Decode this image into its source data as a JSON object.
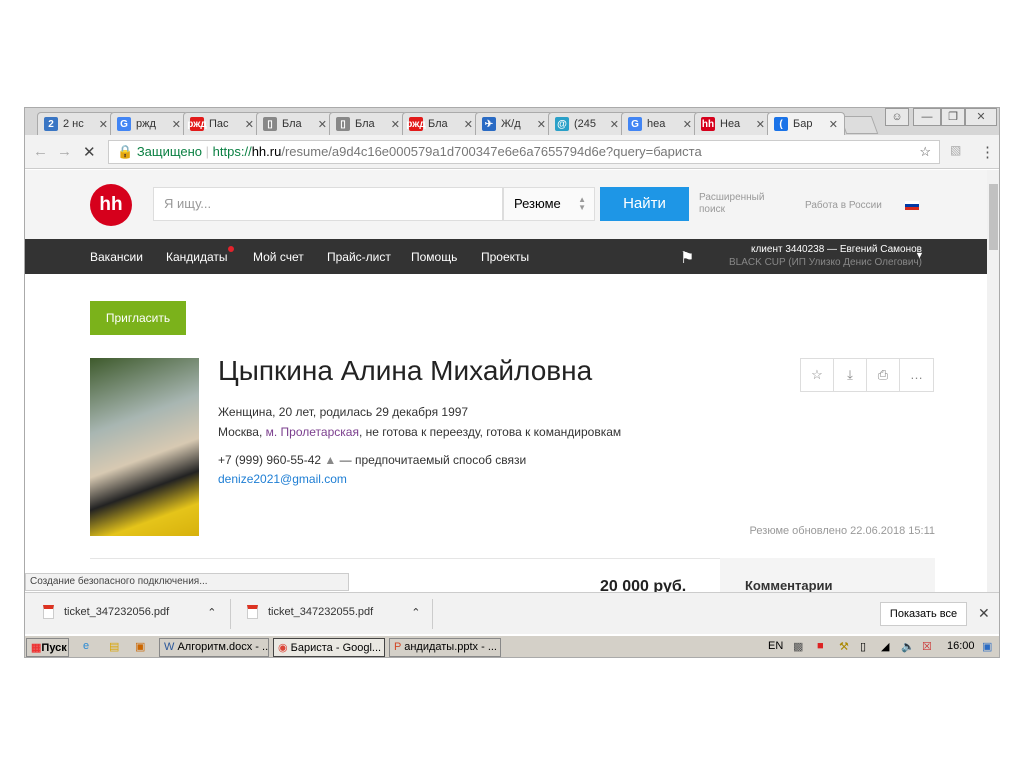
{
  "browser": {
    "tabs": [
      {
        "label": "2 нс",
        "icon": "vk-icon",
        "color": "#3a76c4",
        "glyph": "2"
      },
      {
        "label": "ржд",
        "icon": "google-icon",
        "color": "#4285f4",
        "glyph": "G"
      },
      {
        "label": "Пас",
        "icon": "rzd-icon",
        "color": "#e21a1a",
        "glyph": "ржд"
      },
      {
        "label": "Бла",
        "icon": "document-icon",
        "color": "#888",
        "glyph": "▯"
      },
      {
        "label": "Бла",
        "icon": "document-icon",
        "color": "#888",
        "glyph": "▯"
      },
      {
        "label": "Бла",
        "icon": "rzd-icon",
        "color": "#e21a1a",
        "glyph": "ржд"
      },
      {
        "label": "Ж/д",
        "icon": "tutu-icon",
        "color": "#2a6bc4",
        "glyph": "✈"
      },
      {
        "label": "(245",
        "icon": "mail-icon",
        "color": "#2aa0c8",
        "glyph": "@"
      },
      {
        "label": "hea",
        "icon": "google-icon",
        "color": "#4285f4",
        "glyph": "G"
      },
      {
        "label": "Hea",
        "icon": "hh-icon",
        "color": "#d6001c",
        "glyph": "hh"
      },
      {
        "label": "Бар",
        "icon": "loading-icon",
        "color": "#1a73e8",
        "glyph": "("
      }
    ],
    "secure_label": "Защищено",
    "url_scheme": "https://",
    "url_host": "hh.ru",
    "url_rest": "/resume/a9d4c16e000579a1d700347e6e6a7655794d6e?query=бариста",
    "status": "Создание безопасного подключения..."
  },
  "header": {
    "logo": "hh",
    "search_placeholder": "Я ищу...",
    "search_type": "Резюме",
    "find": "Найти",
    "advanced": "Расширенный поиск",
    "region": "Работа в России"
  },
  "nav": {
    "items": [
      "Вакансии",
      "Кандидаты",
      "Мой счет",
      "Прайс-лист",
      "Помощь",
      "Проекты"
    ],
    "client": "клиент 3440238 — Евгений Самонов",
    "company": "BLACK CUP (ИП Улизко Денис Олегович)"
  },
  "resume": {
    "invite": "Пригласить",
    "name": "Цыпкина Алина Михайловна",
    "info": "Женщина, 20 лет, родилась 29 декабря 1997",
    "city": "Москва, ",
    "metro": "м. Пролетарская",
    "relocation": ", не готова к переезду, готова к командировкам",
    "phone": "+7 (999) 960-55-42",
    "phone_note": " — предпочитаемый способ связи",
    "email": "denize2021@gmail.com",
    "updated": "Резюме обновлено 22.06.2018 15:11",
    "salary": "20 000 руб.",
    "comments": "Комментарии"
  },
  "downloads": {
    "files": [
      "ticket_347232056.pdf",
      "ticket_347232055.pdf"
    ],
    "show_all": "Показать все"
  },
  "taskbar": {
    "start": "Пуск",
    "items": [
      "Алгоритм.docx - ...",
      "Бариста - Googl...",
      "андидаты.pptx - ..."
    ],
    "lang": "EN",
    "time": "16:00"
  }
}
